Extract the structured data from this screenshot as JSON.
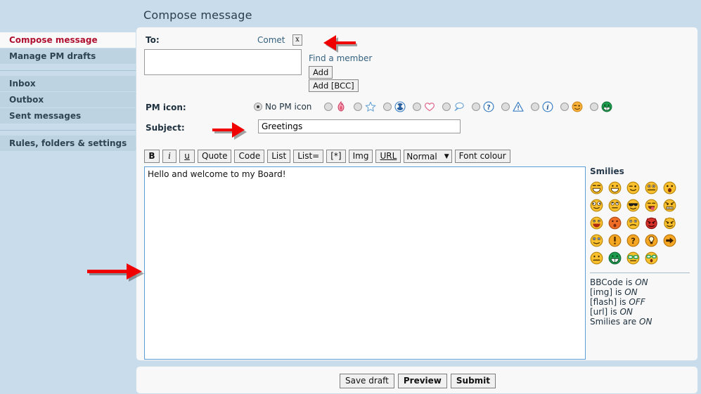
{
  "page": {
    "title": "Compose message",
    "background_color": "#c8dcec",
    "panel_color": "#f8f8f8"
  },
  "sidebar": {
    "groups": [
      {
        "items": [
          {
            "label": "Compose message",
            "active": true
          },
          {
            "label": "Manage PM drafts",
            "active": false
          }
        ]
      },
      {
        "items": [
          {
            "label": "Inbox",
            "active": false
          },
          {
            "label": "Outbox",
            "active": false
          },
          {
            "label": "Sent messages",
            "active": false
          }
        ]
      },
      {
        "items": [
          {
            "label": "Rules, folders & settings",
            "active": false
          }
        ]
      }
    ],
    "active_color": "#b01030",
    "item_color": "#2e4452"
  },
  "form": {
    "to_label": "To:",
    "recipient": "Comet",
    "remove_recipient_label": "x",
    "to_textarea_value": "",
    "to_textarea_placeholder": "",
    "find_member_link": "Find a member",
    "add_button": "Add",
    "add_bcc_button": "Add [BCC]",
    "pm_icon_label": "PM icon:",
    "no_pm_icon_label": "No PM icon",
    "subject_label": "Subject:",
    "subject_value": "Greetings",
    "subject_placeholder": "",
    "message_body": "Hello and welcome to my Board!"
  },
  "pm_icons": [
    {
      "name": "no-icon",
      "selected": true
    },
    {
      "name": "flame-icon",
      "selected": false
    },
    {
      "name": "star-icon",
      "selected": false
    },
    {
      "name": "radioactive-icon",
      "selected": false
    },
    {
      "name": "heart-icon",
      "selected": false
    },
    {
      "name": "speech-bubble-icon",
      "selected": false
    },
    {
      "name": "question-icon",
      "selected": false
    },
    {
      "name": "warning-icon",
      "selected": false
    },
    {
      "name": "info-icon",
      "selected": false
    },
    {
      "name": "smiley-wink-icon",
      "selected": false
    },
    {
      "name": "smiley-green-grin-icon",
      "selected": false
    }
  ],
  "bbcode_toolbar": {
    "buttons": [
      {
        "label": "B",
        "style": "b"
      },
      {
        "label": "i",
        "style": "i"
      },
      {
        "label": "u",
        "style": "u"
      },
      {
        "label": "Quote",
        "style": ""
      },
      {
        "label": "Code",
        "style": ""
      },
      {
        "label": "List",
        "style": ""
      },
      {
        "label": "List=",
        "style": ""
      },
      {
        "label": "[*]",
        "style": ""
      },
      {
        "label": "Img",
        "style": ""
      },
      {
        "label": "URL",
        "style": "url"
      }
    ],
    "font_size_selected": "Normal",
    "font_colour_button": "Font colour"
  },
  "smilies": {
    "title": "Smilies",
    "items": [
      "smiley-big-grin",
      "smiley-grin",
      "smiley-wink",
      "smiley-wide-eyes",
      "smiley-surprised",
      "smiley-crazy-eyes",
      "smiley-rolling-eyes",
      "smiley-cool-shades",
      "smiley-tongue-out",
      "smiley-angry-teeth",
      "smiley-laugh",
      "smiley-blush-orange",
      "smiley-confused",
      "smiley-devil-red",
      "smiley-devil-yellow",
      "smiley-starry-eyes",
      "icon-exclamation",
      "icon-question",
      "icon-idea-bulb",
      "icon-arrow-right",
      "smiley-neutral",
      "smiley-green-grin",
      "smiley-nerd-glasses",
      "smiley-geek-glasses"
    ],
    "bbcode_status": [
      {
        "name": "BBCode is",
        "state": "ON"
      },
      {
        "name": "[img] is",
        "state": "ON"
      },
      {
        "name": "[flash] is",
        "state": "OFF"
      },
      {
        "name": "[url] is",
        "state": "ON"
      },
      {
        "name": "Smilies are",
        "state": "ON"
      }
    ]
  },
  "footer": {
    "save_draft": "Save draft",
    "preview": "Preview",
    "submit": "Submit"
  },
  "annotations": {
    "arrow_color": "#f00000",
    "arrows": [
      {
        "name": "arrow-to-remove-recipient",
        "points_to": "remove-recipient-button"
      },
      {
        "name": "arrow-to-subject",
        "points_to": "subject-input"
      },
      {
        "name": "arrow-to-message-body",
        "points_to": "message-body-textarea"
      }
    ]
  }
}
